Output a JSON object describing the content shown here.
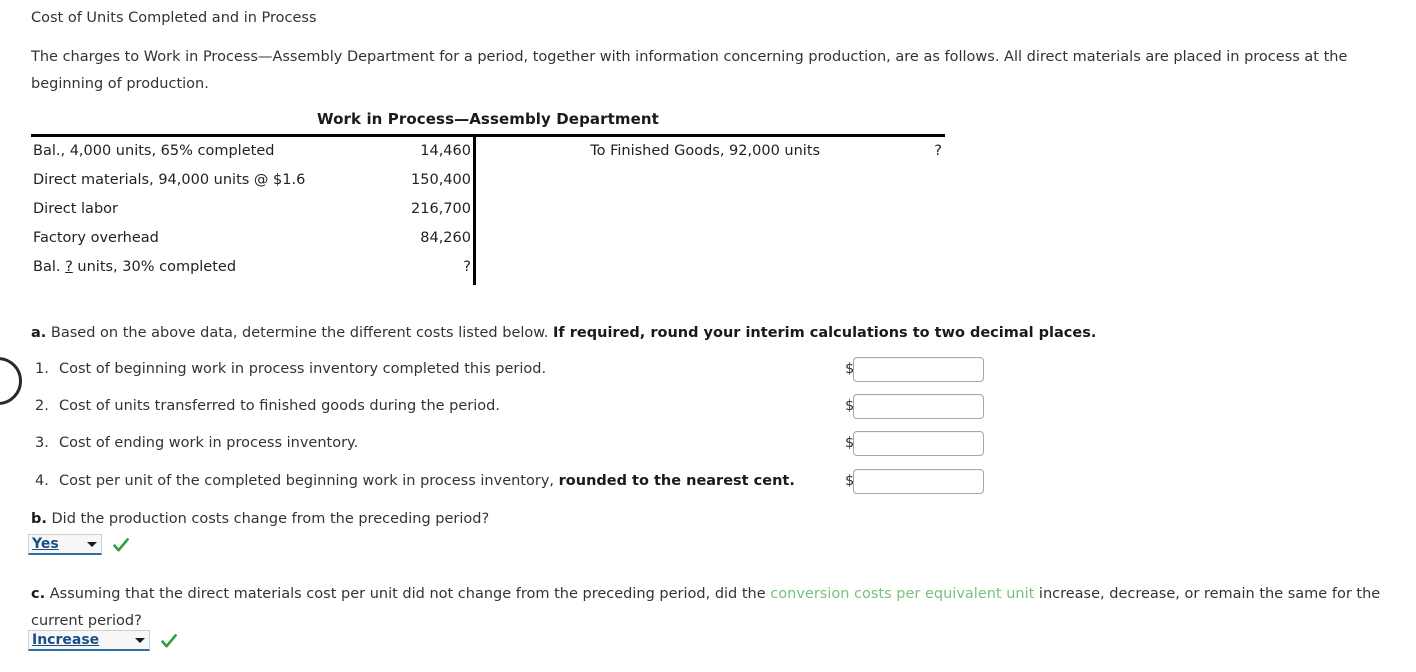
{
  "page_title": "Cost of Units Completed and in Process",
  "intro": "The charges to Work in Process—Assembly Department for a period, together with information concerning production, are as follows. All direct materials are placed in process at the beginning of production.",
  "taccount": {
    "title": "Work in Process—Assembly Department",
    "debit_rows": [
      {
        "label": "Bal., 4,000 units, 65% completed",
        "amount": "14,460"
      },
      {
        "label": "Direct materials, 94,000 units @ $1.6",
        "amount": "150,400"
      },
      {
        "label": "Direct labor",
        "amount": "216,700"
      },
      {
        "label": "Factory overhead",
        "amount": "84,260"
      }
    ],
    "debit_last": {
      "prefix": "Bal. ",
      "unknown": "?",
      "suffix": " units, 30% completed",
      "amount": "?"
    },
    "credit_rows": [
      {
        "label": "To Finished Goods, 92,000 units",
        "amount": "?"
      }
    ]
  },
  "question_a": {
    "label": "a.",
    "text": "Based on the above data, determine the different costs listed below.",
    "bold_tail": "If required, round your interim calculations to two decimal places.",
    "items": [
      {
        "index": "1.",
        "text": "Cost of beginning work in process inventory completed this period.",
        "bold_text": "",
        "currency": "$",
        "value": "",
        "placeholder": ""
      },
      {
        "index": "2.",
        "text": "Cost of units transferred to finished goods during the period.",
        "bold_text": "",
        "currency": "$",
        "value": "",
        "placeholder": ""
      },
      {
        "index": "3.",
        "text": "Cost of ending work in process inventory.",
        "bold_text": "",
        "currency": "$",
        "value": "",
        "placeholder": ""
      },
      {
        "index": "4.",
        "text": "Cost per unit of the completed beginning work in process inventory,",
        "bold_text": "rounded to the nearest cent.",
        "currency": "$",
        "value": "",
        "placeholder": ""
      }
    ]
  },
  "question_b": {
    "label": "b.",
    "text": "Did the production costs change from the preceding period?",
    "answer": "Yes",
    "status": "correct"
  },
  "question_c": {
    "label": "c.",
    "text_before": "Assuming that the direct materials cost per unit did not change from the preceding period, did the",
    "highlight": "conversion costs per equivalent unit",
    "text_after": "increase, decrease, or remain the same for the current period?",
    "answer": "Increase",
    "status": "correct"
  },
  "colors": {
    "text": "#333333",
    "rule": "#000000",
    "select_text": "#1a4f86",
    "select_underline": "#2f6fa8",
    "check_green": "#2e9e3e",
    "term_green": "#7bbf7b",
    "input_border": "#a6a6a6"
  }
}
